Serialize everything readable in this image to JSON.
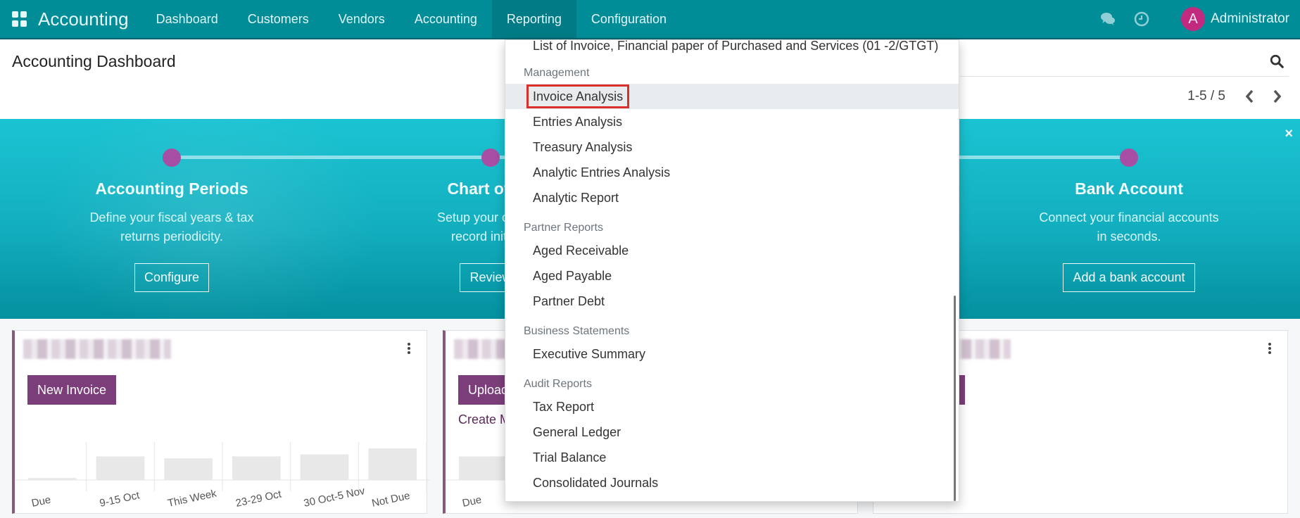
{
  "navbar": {
    "app_name": "Accounting",
    "menu": [
      "Dashboard",
      "Customers",
      "Vendors",
      "Accounting",
      "Reporting",
      "Configuration"
    ],
    "active_menu": "Reporting",
    "icons": [
      "apps-grid-icon",
      "chat-icon",
      "clock-icon"
    ],
    "user": {
      "avatar_letter": "A",
      "name": "Administrator",
      "avatar_color": "#c12a7e"
    },
    "color": "#018d98"
  },
  "control_panel": {
    "title": "Accounting Dashboard",
    "pager": "1-5 / 5"
  },
  "banner": {
    "steps": [
      {
        "title": "Accounting Periods",
        "desc_lines": [
          "Define your fiscal years & tax",
          "returns periodicity."
        ],
        "button": "Configure"
      },
      {
        "title": "Chart of Ac",
        "desc_lines": [
          "Setup your chart of",
          "record initial b"
        ],
        "button": "Review"
      },
      {
        "title": "Bank Account",
        "desc_lines": [
          "Connect your financial accounts",
          "in seconds."
        ],
        "button": "Add a bank account"
      }
    ],
    "close_label": "×"
  },
  "cards": [
    {
      "primary_button": "New Invoice",
      "chart_labels": [
        "Due",
        "9-15 Oct",
        "This Week",
        "23-29 Oct",
        "30 Oct-5 Nov",
        "Not Due"
      ],
      "chart_values": [
        0.05,
        0.6,
        0.55,
        0.6,
        0.65,
        0.8
      ]
    },
    {
      "primary_button": "Upload",
      "link": "Create M",
      "chart_labels": [
        "Due"
      ]
    },
    {}
  ],
  "reporting_menu": {
    "top_item": "List of Invoice, Financial paper of Purchased and Services (01 -2/GTGT)",
    "sections": [
      {
        "header": "Management",
        "items": [
          "Invoice Analysis",
          "Entries Analysis",
          "Treasury Analysis",
          "Analytic Entries Analysis",
          "Analytic Report"
        ]
      },
      {
        "header": "Partner Reports",
        "items": [
          "Aged Receivable",
          "Aged Payable",
          "Partner Debt"
        ]
      },
      {
        "header": "Business Statements",
        "items": [
          "Executive Summary"
        ]
      },
      {
        "header": "Audit Reports",
        "items": [
          "Tax Report",
          "General Ledger",
          "Trial Balance",
          "Consolidated Journals"
        ]
      }
    ],
    "highlighted_item": "Invoice Analysis",
    "highlight_color": "#d9302c"
  }
}
